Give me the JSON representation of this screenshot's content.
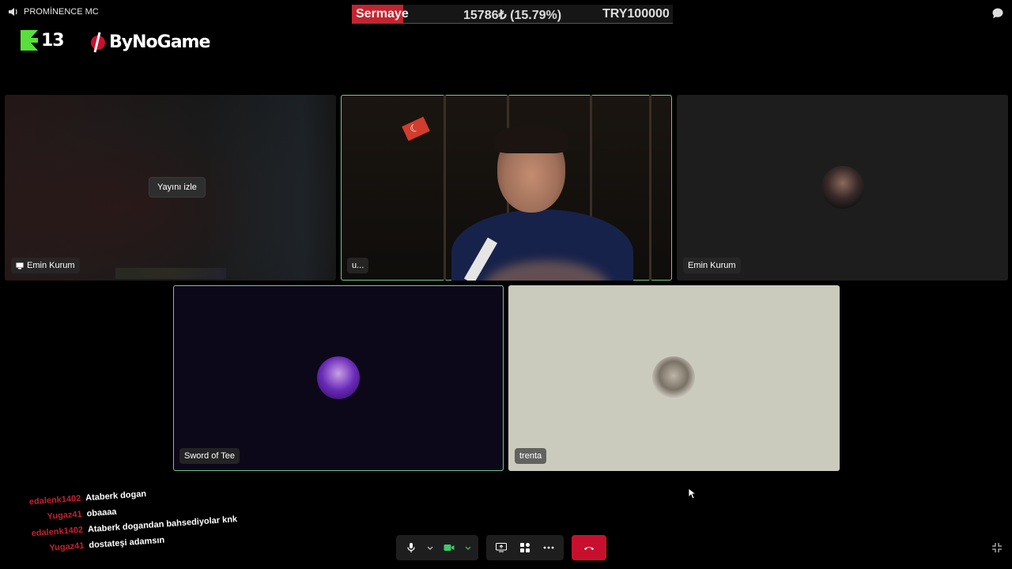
{
  "channel": {
    "name": "PROMİNENCE MC",
    "icon": "speaker-icon"
  },
  "logos": {
    "k13": {
      "letter": "K",
      "number": "13"
    },
    "bynogame": {
      "text": "ByNoGame"
    }
  },
  "capital_bar": {
    "label": "Sermaye",
    "amount": "15786₺ (15.79%)",
    "target": "TRY100000"
  },
  "tiles": [
    {
      "id": "stream",
      "name": "Emin Kurum",
      "action": "Yayını izle",
      "icon": "screen-share-icon"
    },
    {
      "id": "webcam",
      "name": "u...",
      "speaking": true
    },
    {
      "id": "emin",
      "name": "Emin Kurum"
    },
    {
      "id": "sword",
      "name": "Sword of Tee",
      "speaking": true
    },
    {
      "id": "trenta",
      "name": "trenta"
    }
  ],
  "chat": [
    {
      "user": "edalenk1402",
      "text": "Ataberk dogan"
    },
    {
      "user": "Yugaz41",
      "text": "obaaaa"
    },
    {
      "user": "edalenk1402",
      "text": "Ataberk dogandan bahsediyolar knk"
    },
    {
      "user": "Yugaz41",
      "text": "dostateşi adamsın"
    }
  ],
  "controls": {
    "mic": "microphone-icon",
    "camera": "camera-icon",
    "share": "screen-share-icon",
    "activities": "activities-icon",
    "more": "more-icon",
    "hangup": "hang-up-icon"
  },
  "colors": {
    "accent_red": "#c8102e",
    "speaking_green": "#6fc98b",
    "capital_red": "#c4242f",
    "k13_green": "#58e03a"
  }
}
